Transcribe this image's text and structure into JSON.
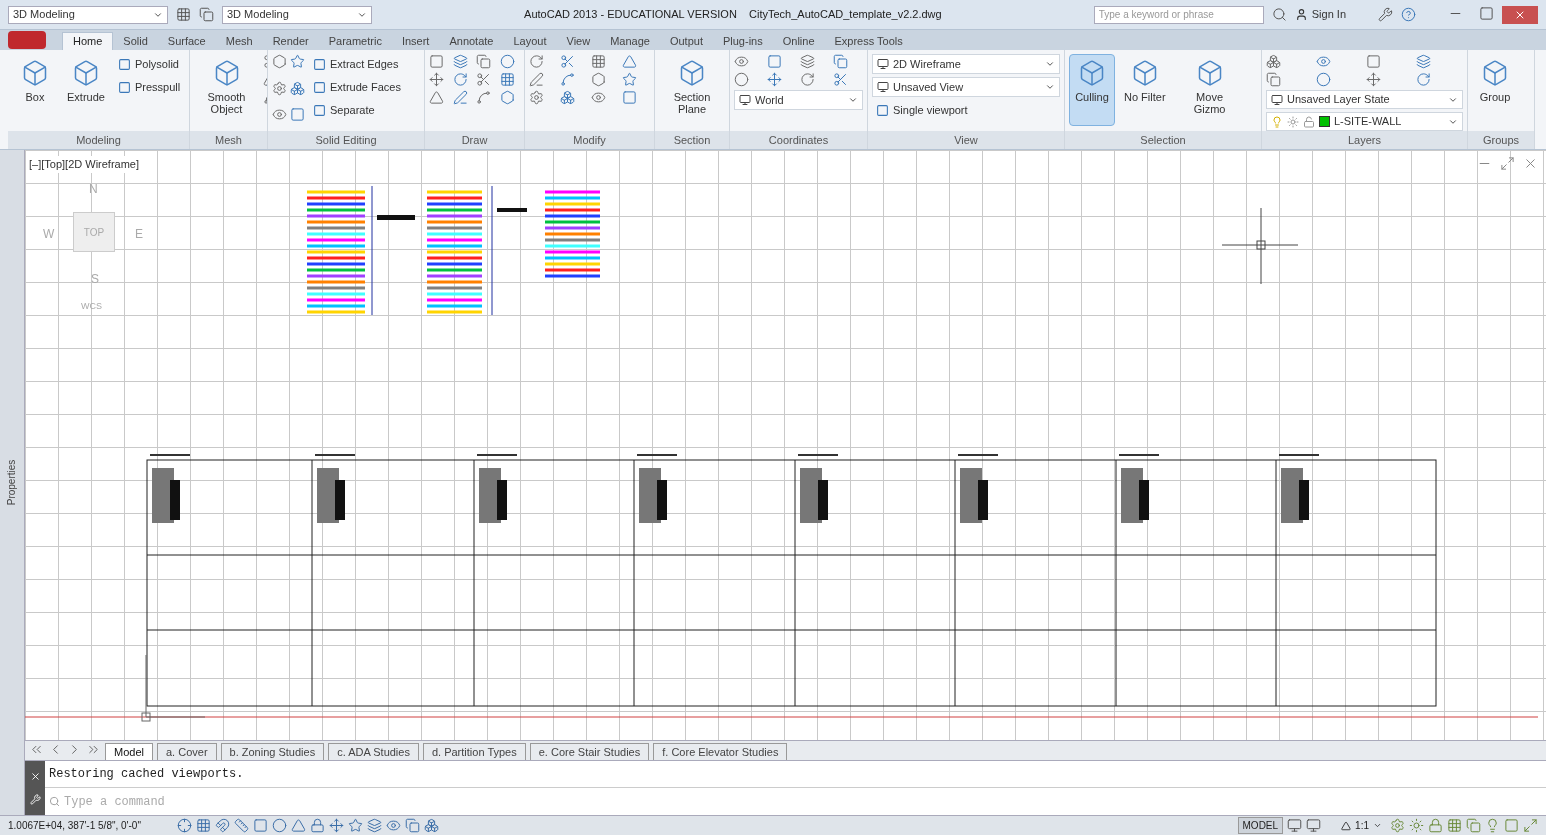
{
  "title_bar": {
    "workspace": "3D Modeling",
    "workspace_2": "3D Modeling",
    "title": "AutoCAD 2013 - EDUCATIONAL VERSION    CityTech_AutoCAD_template_v2.2.dwg",
    "search": {
      "placeholder": "Type a keyword or phrase"
    },
    "sign_in": "Sign In"
  },
  "ribbon_tabs": [
    {
      "label": "Home",
      "selected": true
    },
    {
      "label": "Solid",
      "selected": false
    },
    {
      "label": "Surface",
      "selected": false
    },
    {
      "label": "Mesh",
      "selected": false
    },
    {
      "label": "Render",
      "selected": false
    },
    {
      "label": "Parametric",
      "selected": false
    },
    {
      "label": "Insert",
      "selected": false
    },
    {
      "label": "Annotate",
      "selected": false
    },
    {
      "label": "Layout",
      "selected": false
    },
    {
      "label": "View",
      "selected": false
    },
    {
      "label": "Manage",
      "selected": false
    },
    {
      "label": "Output",
      "selected": false
    },
    {
      "label": "Plug-ins",
      "selected": false
    },
    {
      "label": "Online",
      "selected": false
    },
    {
      "label": "Express Tools",
      "selected": false
    }
  ],
  "ribbon_panels": [
    {
      "title": "Modeling",
      "items": [
        {
          "kind": "large",
          "label": "Box",
          "selected": false
        },
        {
          "kind": "large",
          "label": "Extrude",
          "selected": false
        },
        {
          "kind": "small",
          "label": "Polysolid"
        },
        {
          "kind": "small",
          "label": "Presspull"
        }
      ]
    },
    {
      "title": "Mesh",
      "items": [
        {
          "kind": "large",
          "label": "Smooth Object",
          "selected": false
        },
        {
          "kind": "icons"
        }
      ]
    },
    {
      "title": "Solid Editing",
      "items": [
        {
          "kind": "icons"
        },
        {
          "kind": "small",
          "label": "Extract Edges"
        },
        {
          "kind": "small",
          "label": "Extrude Faces"
        },
        {
          "kind": "small",
          "label": "Separate"
        }
      ]
    },
    {
      "title": "Draw",
      "items": [
        {
          "kind": "icons"
        }
      ]
    },
    {
      "title": "Modify",
      "items": [
        {
          "kind": "icons"
        }
      ]
    },
    {
      "title": "Section",
      "items": [
        {
          "kind": "large",
          "label": "Section Plane",
          "selected": false
        }
      ]
    },
    {
      "title": "Coordinates",
      "items": [
        {
          "kind": "icons"
        },
        {
          "kind": "combo",
          "label": "World"
        }
      ]
    },
    {
      "title": "View",
      "items": [
        {
          "kind": "combo",
          "label": "2D Wireframe"
        },
        {
          "kind": "combo",
          "label": "Unsaved View"
        },
        {
          "kind": "small",
          "label": "Single viewport"
        }
      ]
    },
    {
      "title": "Selection",
      "items": [
        {
          "kind": "large",
          "label": "Culling",
          "selected": true
        },
        {
          "kind": "large",
          "label": "No Filter",
          "selected": false
        },
        {
          "kind": "large",
          "label": "Move Gizmo",
          "selected": false
        }
      ]
    },
    {
      "title": "Layers",
      "items": [
        {
          "kind": "icons"
        },
        {
          "kind": "combo",
          "label": "Unsaved Layer State"
        },
        {
          "kind": "layer",
          "label": "L-SITE-WALL",
          "color": "#00c000"
        }
      ]
    },
    {
      "title": "Groups",
      "items": [
        {
          "kind": "large",
          "label": "Group",
          "selected": false
        }
      ]
    }
  ],
  "side_palette": {
    "label": "Properties"
  },
  "viewport": {
    "label": "[–][Top][2D Wireframe]",
    "viewcube": {
      "north": "N",
      "west": "W",
      "face": "TOP",
      "east": "E",
      "south": "S",
      "ucs": "WCS"
    }
  },
  "layout_tabs": [
    {
      "label": "Model",
      "selected": true
    },
    {
      "label": "a. Cover",
      "selected": false
    },
    {
      "label": "b. Zoning Studies",
      "selected": false
    },
    {
      "label": "c. ADA Studies",
      "selected": false
    },
    {
      "label": "d. Partition Types",
      "selected": false
    },
    {
      "label": "e. Core Stair Studies",
      "selected": false
    },
    {
      "label": "f. Core Elevator Studies",
      "selected": false
    }
  ],
  "command_line": {
    "history": "Restoring cached viewports.",
    "placeholder": "Type a command"
  },
  "status_bar": {
    "coordinates": "1.0067E+04, 387'-1 5/8\", 0'-0\"",
    "space": "MODEL",
    "scale": "1:1"
  }
}
